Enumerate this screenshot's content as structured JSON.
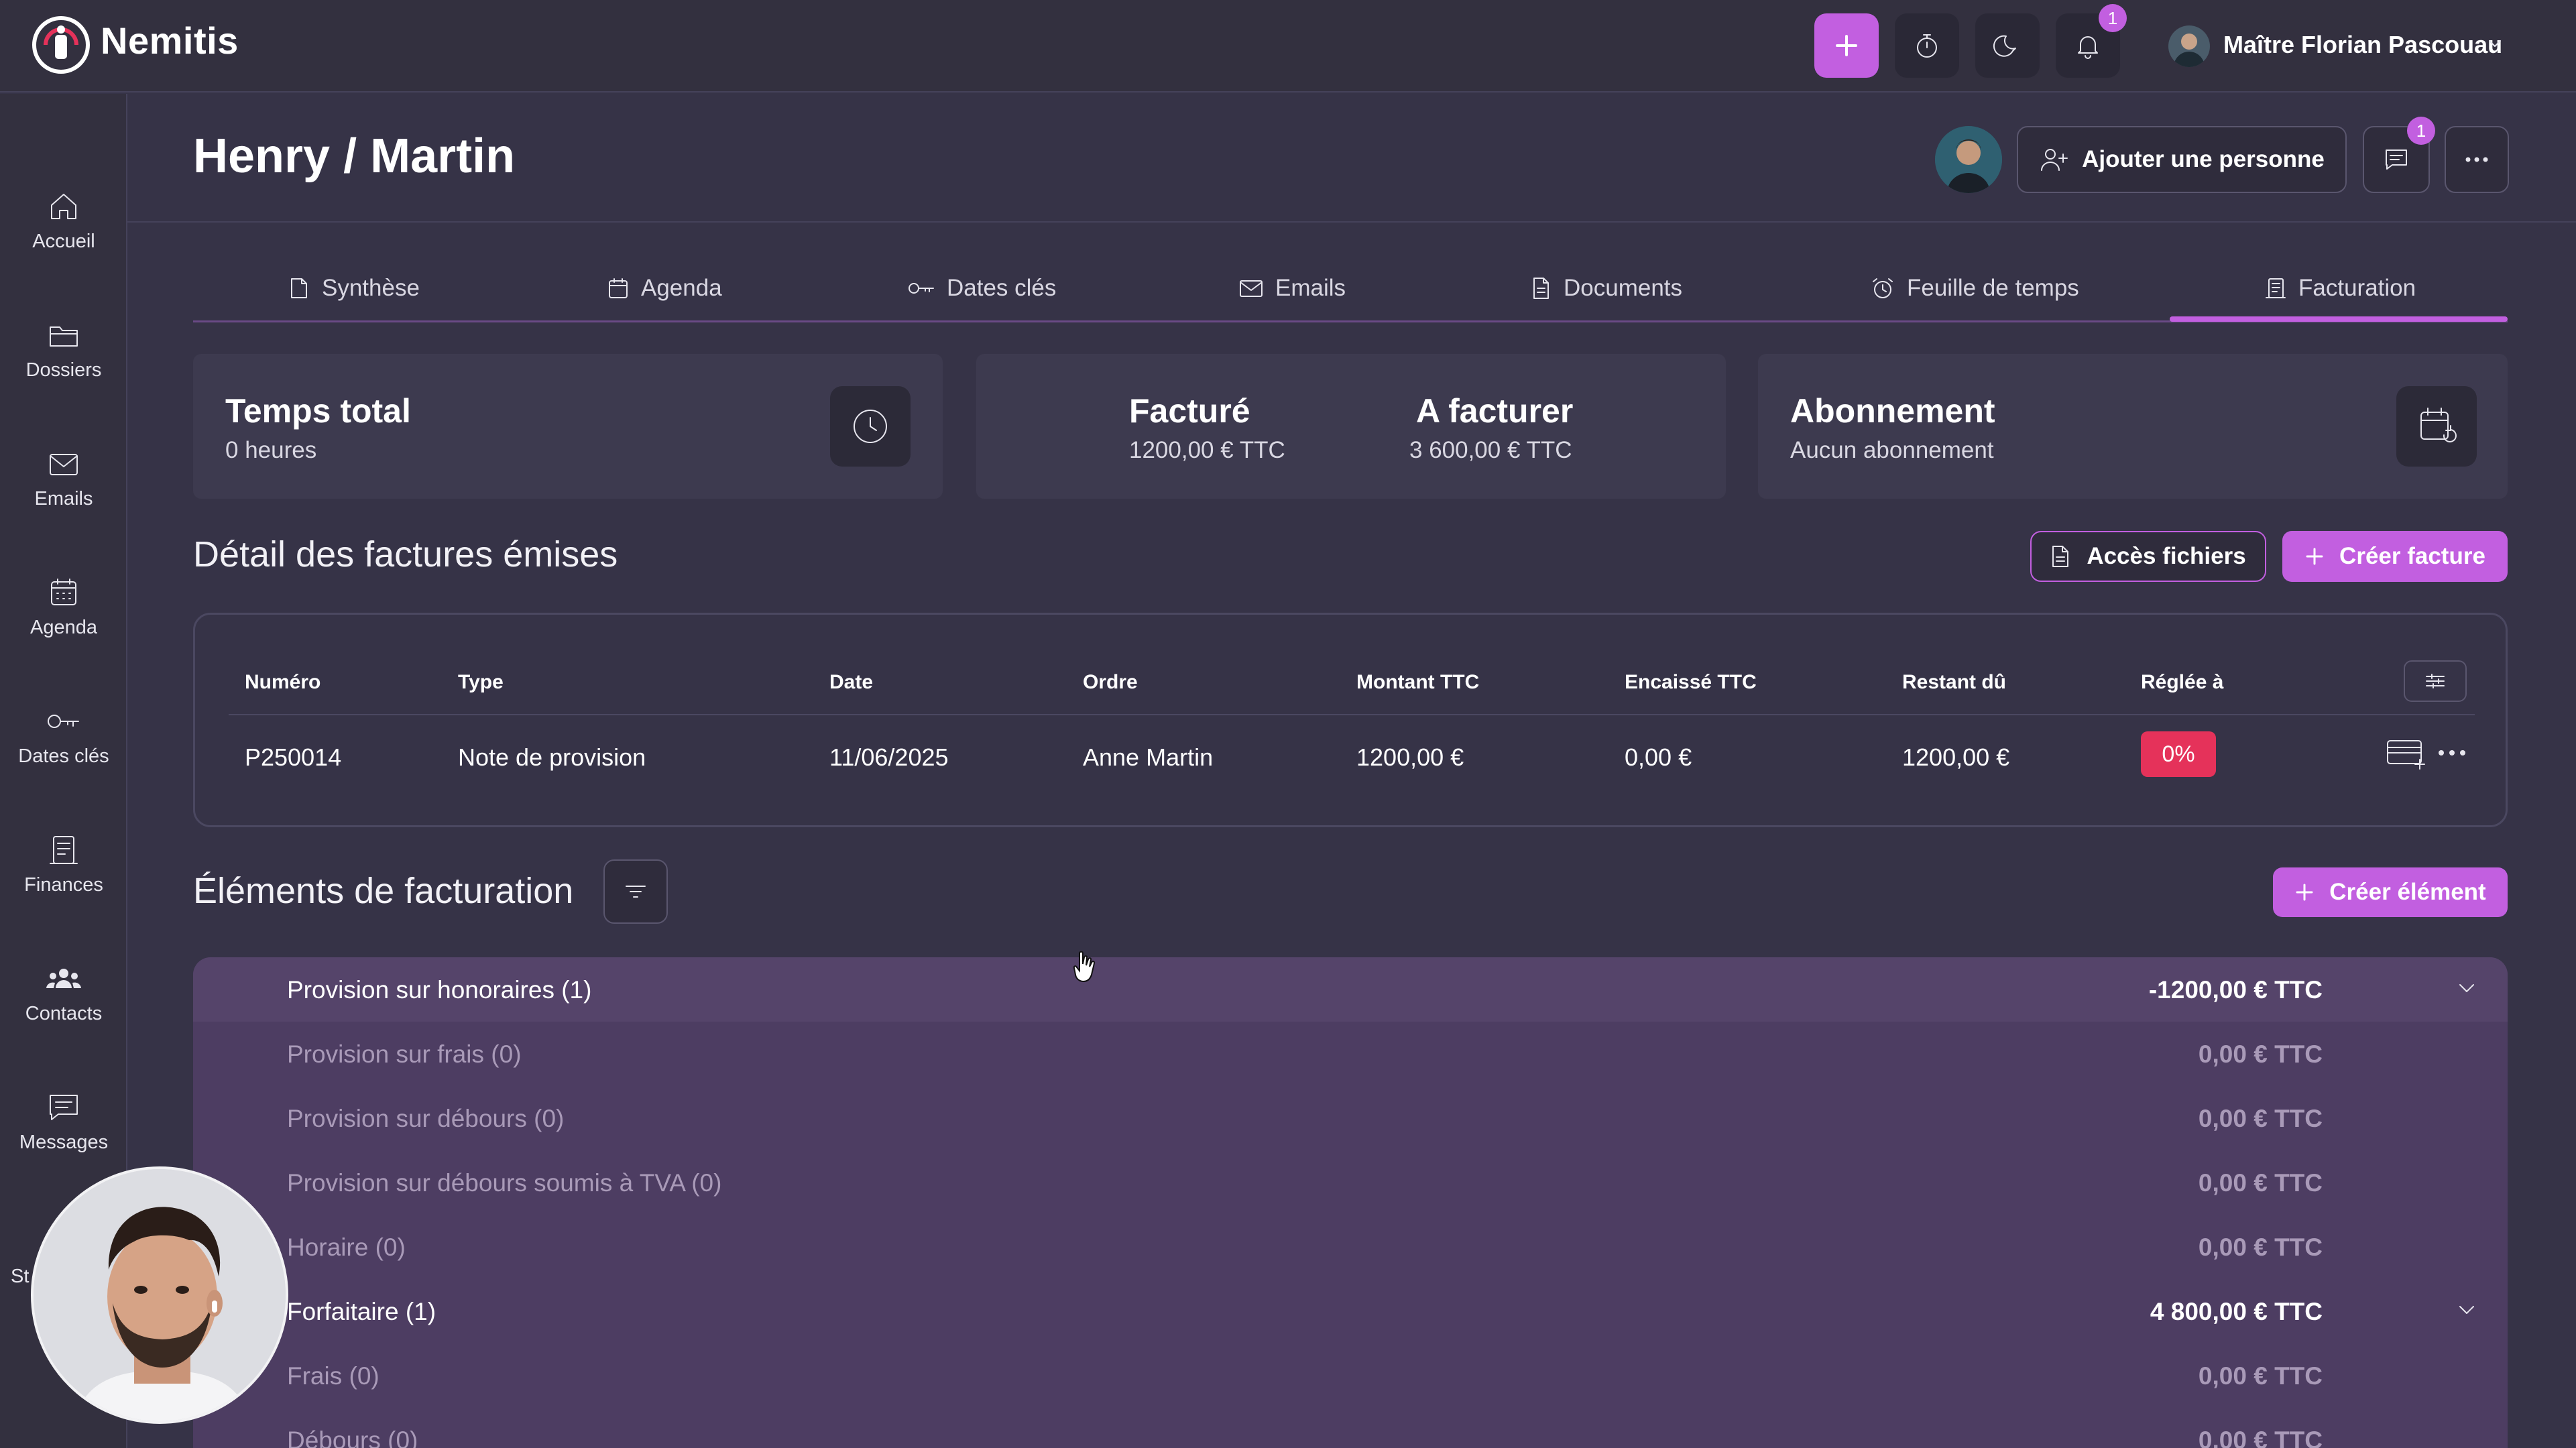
{
  "app": {
    "brand": "Nemitis",
    "user_name": "Maître Florian Pascouau",
    "notification_count": "1",
    "accent_color": "#c25fe0"
  },
  "sidebar": {
    "items": [
      {
        "label": "Accueil",
        "icon": "home-icon"
      },
      {
        "label": "Dossiers",
        "icon": "folder-icon"
      },
      {
        "label": "Emails",
        "icon": "mail-icon"
      },
      {
        "label": "Agenda",
        "icon": "calendar-icon"
      },
      {
        "label": "Dates clés",
        "icon": "key-icon"
      },
      {
        "label": "Finances",
        "icon": "receipt-icon"
      },
      {
        "label": "Contacts",
        "icon": "people-icon"
      },
      {
        "label": "Messages",
        "icon": "message-icon"
      }
    ],
    "partial_label": "St"
  },
  "header": {
    "title": "Henry / Martin",
    "add_person_label": "Ajouter une personne",
    "messages_count": "1"
  },
  "tabs": [
    {
      "label": "Synthèse"
    },
    {
      "label": "Agenda"
    },
    {
      "label": "Dates clés"
    },
    {
      "label": "Emails"
    },
    {
      "label": "Documents"
    },
    {
      "label": "Feuille de temps"
    },
    {
      "label": "Facturation"
    }
  ],
  "cards": {
    "time": {
      "title": "Temps total",
      "value": "0 heures"
    },
    "billed": {
      "title": "Facturé",
      "value": "1200,00 € TTC"
    },
    "to_bill": {
      "title": "A facturer",
      "value": "3 600,00 € TTC"
    },
    "subscription": {
      "title": "Abonnement",
      "value": "Aucun abonnement"
    }
  },
  "invoices": {
    "title": "Détail des factures émises",
    "files_button": "Accès fichiers",
    "create_button": "Créer facture",
    "columns": [
      "Numéro",
      "Type",
      "Date",
      "Ordre",
      "Montant TTC",
      "Encaissé TTC",
      "Restant dû",
      "Réglée à"
    ],
    "rows": [
      {
        "numero": "P250014",
        "type": "Note de provision",
        "date": "11/06/2025",
        "ordre": "Anne Martin",
        "montant": "1200,00 €",
        "encaisse": "0,00 €",
        "restant": "1200,00 €",
        "reglee": "0%"
      }
    ]
  },
  "billing": {
    "title": "Éléments de facturation",
    "create_button": "Créer élément",
    "rows": [
      {
        "label": "Provision sur honoraires (1)",
        "amount": "-1200,00 € TTC"
      },
      {
        "label": "Provision sur frais (0)",
        "amount": "0,00 € TTC"
      },
      {
        "label": "Provision sur débours (0)",
        "amount": "0,00 € TTC"
      },
      {
        "label": "Provision sur débours soumis à TVA (0)",
        "amount": "0,00 € TTC"
      },
      {
        "label": "Horaire (0)",
        "amount": "0,00 € TTC"
      },
      {
        "label": "Forfaitaire (1)",
        "amount": "4 800,00 € TTC"
      },
      {
        "label": "Frais (0)",
        "amount": "0,00 € TTC"
      },
      {
        "label": "Débours (0)",
        "amount": "0,00 € TTC"
      }
    ]
  }
}
